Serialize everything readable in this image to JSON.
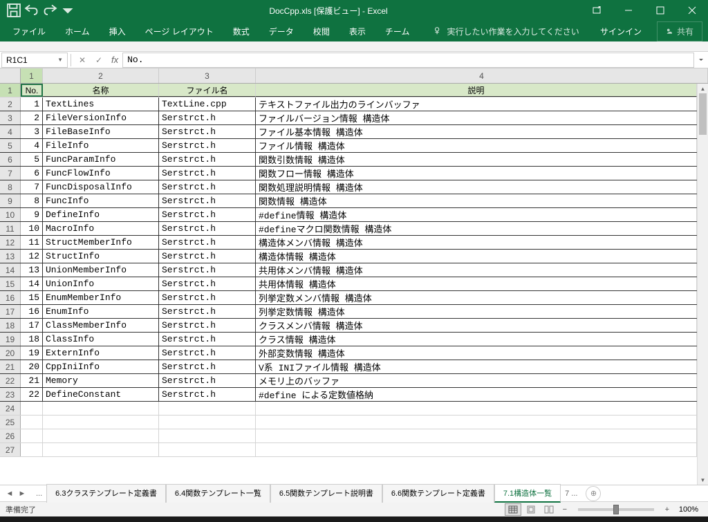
{
  "title": "DocCpp.xls [保護ビュー] - Excel",
  "qa": {
    "save": "保存",
    "undo": "元に戻す",
    "redo": "やり直し"
  },
  "ribbon": {
    "tabs": [
      "ファイル",
      "ホーム",
      "挿入",
      "ページ レイアウト",
      "数式",
      "データ",
      "校閲",
      "表示",
      "チーム"
    ],
    "tell_me": "実行したい作業を入力してください",
    "signin": "サインイン",
    "share": "共有"
  },
  "formula_bar": {
    "name_box": "R1C1",
    "formula": "No."
  },
  "col_headers": [
    "1",
    "2",
    "3",
    "4"
  ],
  "headers": {
    "no": "No.",
    "name": "名称",
    "file": "ファイル名",
    "desc": "説明"
  },
  "rows": [
    {
      "no": "1",
      "name": "TextLines",
      "file": "TextLine.cpp",
      "desc": "テキストファイル出力のラインバッファ"
    },
    {
      "no": "2",
      "name": "FileVersionInfo",
      "file": "Serstrct.h",
      "desc": "ファイルバージョン情報 構造体"
    },
    {
      "no": "3",
      "name": "FileBaseInfo",
      "file": "Serstrct.h",
      "desc": "ファイル基本情報 構造体"
    },
    {
      "no": "4",
      "name": "FileInfo",
      "file": "Serstrct.h",
      "desc": "ファイル情報 構造体"
    },
    {
      "no": "5",
      "name": "FuncParamInfo",
      "file": "Serstrct.h",
      "desc": "関数引数情報 構造体"
    },
    {
      "no": "6",
      "name": "FuncFlowInfo",
      "file": "Serstrct.h",
      "desc": "関数フロー情報 構造体"
    },
    {
      "no": "7",
      "name": "FuncDisposalInfo",
      "file": "Serstrct.h",
      "desc": "関数処理説明情報 構造体"
    },
    {
      "no": "8",
      "name": "FuncInfo",
      "file": "Serstrct.h",
      "desc": "関数情報 構造体"
    },
    {
      "no": "9",
      "name": "DefineInfo",
      "file": "Serstrct.h",
      "desc": "#define情報 構造体"
    },
    {
      "no": "10",
      "name": "MacroInfo",
      "file": "Serstrct.h",
      "desc": "#defineマクロ関数情報 構造体"
    },
    {
      "no": "11",
      "name": "StructMemberInfo",
      "file": "Serstrct.h",
      "desc": "構造体メンバ情報 構造体"
    },
    {
      "no": "12",
      "name": "StructInfo",
      "file": "Serstrct.h",
      "desc": "構造体情報 構造体"
    },
    {
      "no": "13",
      "name": "UnionMemberInfo",
      "file": "Serstrct.h",
      "desc": "共用体メンバ情報 構造体"
    },
    {
      "no": "14",
      "name": "UnionInfo",
      "file": "Serstrct.h",
      "desc": "共用体情報 構造体"
    },
    {
      "no": "15",
      "name": "EnumMemberInfo",
      "file": "Serstrct.h",
      "desc": "列挙定数メンバ情報 構造体"
    },
    {
      "no": "16",
      "name": "EnumInfo",
      "file": "Serstrct.h",
      "desc": "列挙定数情報 構造体"
    },
    {
      "no": "17",
      "name": "ClassMemberInfo",
      "file": "Serstrct.h",
      "desc": "クラスメンバ情報 構造体"
    },
    {
      "no": "18",
      "name": "ClassInfo",
      "file": "Serstrct.h",
      "desc": "クラス情報 構造体"
    },
    {
      "no": "19",
      "name": "ExternInfo",
      "file": "Serstrct.h",
      "desc": "外部変数情報 構造体"
    },
    {
      "no": "20",
      "name": "CppIniInfo",
      "file": "Serstrct.h",
      "desc": "V系 INIファイル情報 構造体"
    },
    {
      "no": "21",
      "name": "Memory",
      "file": "Serstrct.h",
      "desc": "メモリ上のバッファ"
    },
    {
      "no": "22",
      "name": "DefineConstant",
      "file": "Serstrct.h",
      "desc": "#define による定数値格納"
    }
  ],
  "empty_row_nums": [
    "24",
    "25",
    "26",
    "27"
  ],
  "sheet_tabs": {
    "tabs": [
      "6.3クラステンプレート定義書",
      "6.4関数テンプレート一覧",
      "6.5関数テンプレート説明書",
      "6.6関数テンプレート定義書",
      "7.1構造体一覧"
    ],
    "overflow": "7 ...",
    "active_index": 4
  },
  "status": {
    "ready": "準備完了",
    "zoom": "100%"
  }
}
